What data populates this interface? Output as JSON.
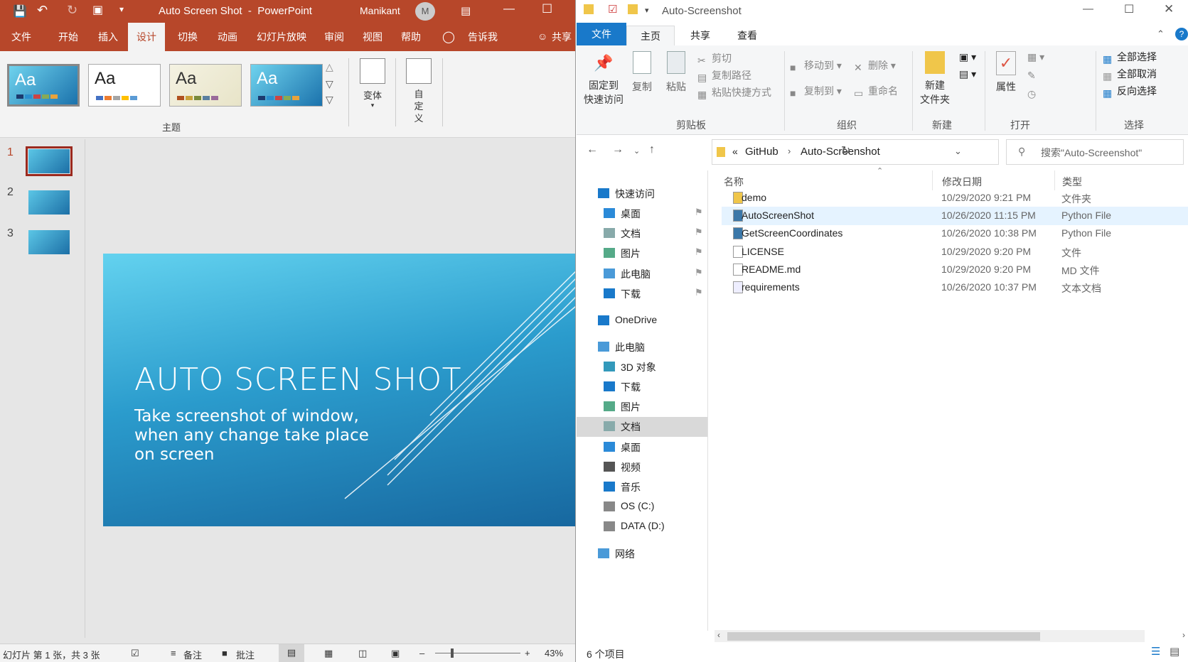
{
  "ppt": {
    "window_title": "Auto Screen Shot  -  PowerPoint",
    "user_name": "Manikant",
    "user_initial": "M",
    "tabs": [
      "文件",
      "开始",
      "插入",
      "设计",
      "切换",
      "动画",
      "幻灯片放映",
      "审阅",
      "视图",
      "帮助",
      "告诉我"
    ],
    "share": "共享",
    "ribbon": {
      "theme_label": "主题",
      "variants_label": "变体",
      "customize_label": "自定义",
      "theme_sample": "Aa"
    },
    "slides": [
      "1",
      "2",
      "3"
    ],
    "slide": {
      "title": "AUTO SCREEN SHOT",
      "subtitle": "Take screenshot of window, when any change take place on screen"
    },
    "status": {
      "slide_info": "幻灯片 第 1 张，共 3 张",
      "notes": "备注",
      "comments": "批注",
      "zoom": "43%"
    }
  },
  "explorer": {
    "window_title": "Auto-Screenshot",
    "tabs": [
      "文件",
      "主页",
      "共享",
      "查看"
    ],
    "ribbon": {
      "pin": "固定到",
      "pin2": "快速访问",
      "copy": "复制",
      "paste": "粘贴",
      "cut": "剪切",
      "copy_path": "复制路径",
      "paste_shortcut": "粘贴快捷方式",
      "move_to": "移动到",
      "copy_to": "复制到",
      "delete": "删除",
      "rename": "重命名",
      "new_folder": "新建",
      "new_folder2": "文件夹",
      "properties": "属性",
      "select_all": "全部选择",
      "select_none": "全部取消",
      "invert_selection": "反向选择",
      "groups": [
        "剪贴板",
        "组织",
        "新建",
        "打开",
        "选择"
      ]
    },
    "address": {
      "prefix": "«",
      "path": [
        "GitHub",
        "Auto-Screenshot"
      ]
    },
    "search_placeholder": "搜索\"Auto-Screenshot\"",
    "nav": [
      {
        "label": "快速访问",
        "icon": "star-icon",
        "indent": 0,
        "pin": false
      },
      {
        "label": "桌面",
        "icon": "desktop-icon",
        "indent": 1,
        "pin": true
      },
      {
        "label": "文档",
        "icon": "document-icon",
        "indent": 1,
        "pin": true
      },
      {
        "label": "图片",
        "icon": "pictures-icon",
        "indent": 1,
        "pin": true
      },
      {
        "label": "此电脑",
        "icon": "computer-icon",
        "indent": 1,
        "pin": true
      },
      {
        "label": "下载",
        "icon": "download-icon",
        "indent": 1,
        "pin": true
      },
      {
        "label": "OneDrive",
        "icon": "cloud-icon",
        "indent": 0,
        "pin": false
      },
      {
        "label": "此电脑",
        "icon": "computer-icon",
        "indent": 0,
        "pin": false
      },
      {
        "label": "3D 对象",
        "icon": "cube-icon",
        "indent": 1,
        "pin": false
      },
      {
        "label": "下载",
        "icon": "download-icon",
        "indent": 1,
        "pin": false
      },
      {
        "label": "图片",
        "icon": "pictures-icon",
        "indent": 1,
        "pin": false
      },
      {
        "label": "文档",
        "icon": "document-icon",
        "indent": 1,
        "pin": false
      },
      {
        "label": "桌面",
        "icon": "desktop-icon",
        "indent": 1,
        "pin": false
      },
      {
        "label": "视频",
        "icon": "video-icon",
        "indent": 1,
        "pin": false
      },
      {
        "label": "音乐",
        "icon": "music-icon",
        "indent": 1,
        "pin": false
      },
      {
        "label": "OS (C:)",
        "icon": "drive-icon",
        "indent": 1,
        "pin": false
      },
      {
        "label": "DATA (D:)",
        "icon": "drive-icon",
        "indent": 1,
        "pin": false
      },
      {
        "label": "网络",
        "icon": "network-icon",
        "indent": 0,
        "pin": false
      }
    ],
    "columns": {
      "name": "名称",
      "date": "修改日期",
      "type": "类型"
    },
    "files": [
      {
        "name": "demo",
        "date": "10/29/2020 9:21 PM",
        "type": "文件夹",
        "icon": "folder-icon"
      },
      {
        "name": "AutoScreenShot",
        "date": "10/26/2020 11:15 PM",
        "type": "Python File",
        "icon": "python-file-icon"
      },
      {
        "name": "GetScreenCoordinates",
        "date": "10/26/2020 10:38 PM",
        "type": "Python File",
        "icon": "python-file-icon"
      },
      {
        "name": "LICENSE",
        "date": "10/29/2020 9:20 PM",
        "type": "文件",
        "icon": "file-icon"
      },
      {
        "name": "README.md",
        "date": "10/29/2020 9:20 PM",
        "type": "MD 文件",
        "icon": "file-icon"
      },
      {
        "name": "requirements",
        "date": "10/26/2020 10:37 PM",
        "type": "文本文档",
        "icon": "text-file-icon"
      }
    ],
    "status": "6 个项目"
  }
}
